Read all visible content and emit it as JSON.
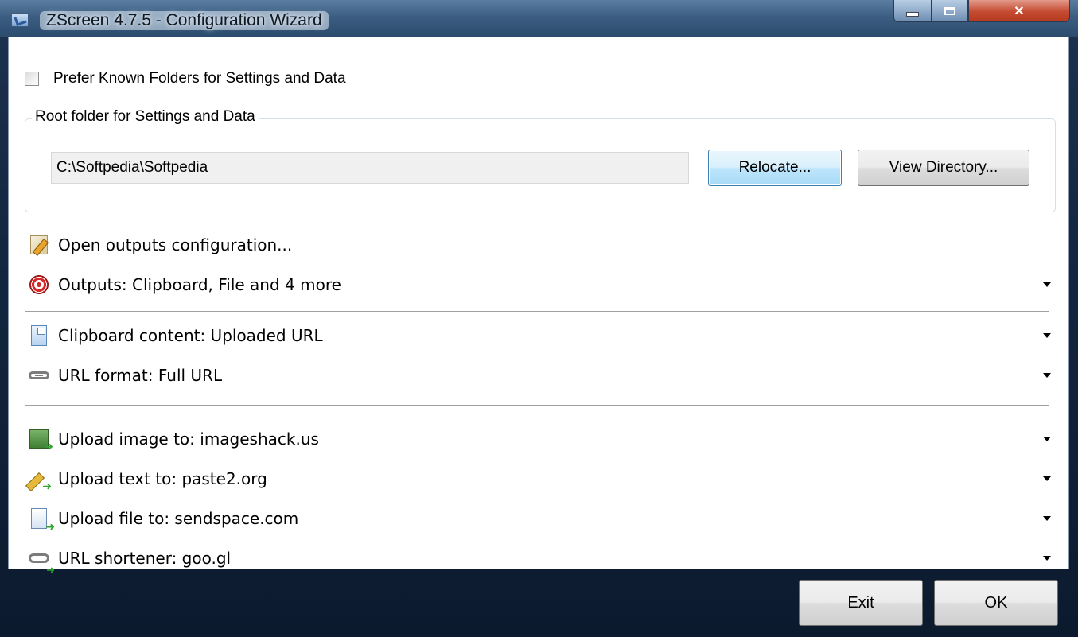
{
  "window": {
    "title": "ZScreen 4.7.5 - Configuration Wizard"
  },
  "settings": {
    "prefer_known_folders_label": "Prefer Known Folders for Settings and Data",
    "prefer_known_folders_checked": false,
    "root_folder_group_label": "Root folder for Settings and Data",
    "root_folder_path": "C:\\Softpedia\\Softpedia",
    "relocate_label": "Relocate...",
    "view_directory_label": "View Directory..."
  },
  "options": {
    "open_outputs": {
      "label": "Open outputs configuration...",
      "icon": "edit-doc-icon"
    },
    "outputs": {
      "label": "Outputs: Clipboard, File and 4 more",
      "icon": "target-icon"
    },
    "clipboard_content": {
      "label": "Clipboard content: Uploaded URL",
      "icon": "clipboard-icon"
    },
    "url_format": {
      "label": "URL format: Full URL",
      "icon": "link-icon"
    },
    "upload_image": {
      "label": "Upload image to: imageshack.us",
      "icon": "image-upload-icon"
    },
    "upload_text": {
      "label": "Upload text to: paste2.org",
      "icon": "text-upload-icon"
    },
    "upload_file": {
      "label": "Upload file to: sendspace.com",
      "icon": "file-upload-icon"
    },
    "url_shortener": {
      "label": "URL shortener: goo.gl",
      "icon": "link-shorten-icon"
    }
  },
  "footer": {
    "exit_label": "Exit",
    "ok_label": "OK"
  },
  "colors": {
    "accent_button_border": "#3c7fb1",
    "close_button": "#c44a30",
    "client_background": "#ffffff"
  }
}
